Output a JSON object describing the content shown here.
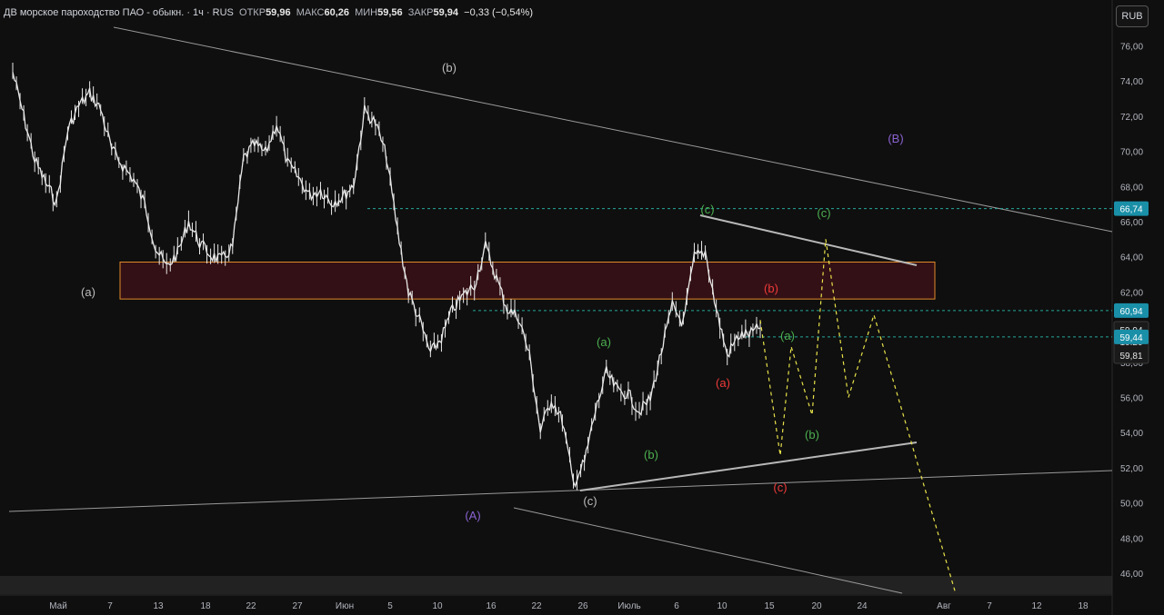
{
  "header": {
    "symbol": "ДВ морское пароходство ПАО - обыкн.",
    "interval": "· 1ч · RUS",
    "open_label": "ОТКР",
    "open": "59,96",
    "high_label": "МАКС",
    "high": "60,26",
    "low_label": "МИН",
    "low": "59,56",
    "close_label": "ЗАКР",
    "close": "59,94",
    "change": "−0,33 (−0,54%)"
  },
  "currency_button": "RUB",
  "colors": {
    "background": "#0f0f0f",
    "candles": "#e8e8e8",
    "zone_fill": "#3a1016",
    "zone_border": "#e08a2a",
    "projection": "#e8e24a",
    "level_line": "#26a69a",
    "wave_green": "#4caf50",
    "wave_red": "#ef3a3a",
    "wave_purple": "#8a63d2",
    "wave_gray": "#bdbdbd",
    "badge_teal": "#1a8fa8"
  },
  "chart_data": {
    "type": "line",
    "title": "",
    "ylim": [
      45,
      77.5
    ],
    "y_ticks": [
      "46,00",
      "48,00",
      "50,00",
      "52,00",
      "54,00",
      "56,00",
      "58,00",
      "60,00",
      "62,00",
      "64,00",
      "66,00",
      "68,00",
      "70,00",
      "72,00",
      "74,00",
      "76,00"
    ],
    "x_ticks": [
      "Май",
      "7",
      "13",
      "18",
      "22",
      "27",
      "Июн",
      "5",
      "10",
      "16",
      "22",
      "26",
      "Июль",
      "6",
      "10",
      "15",
      "20",
      "24",
      "Авг",
      "7",
      "12",
      "18"
    ],
    "series": [
      {
        "values": [
          74.5,
          72.0,
          69.5,
          68.2,
          67.1,
          71.2,
          72.6,
          73.3,
          72.4,
          70.1,
          69.2,
          68.4,
          67.0,
          64.5,
          63.4,
          64.2,
          66.0,
          64.8,
          64.1,
          63.8,
          64.6,
          69.6,
          70.4,
          69.9,
          71.6,
          69.3,
          68.5,
          67.5,
          67.8,
          67.1,
          67.4,
          68.1,
          72.3,
          71.6,
          69.7,
          65.5,
          62.0,
          60.4,
          58.5,
          59.4,
          61.0,
          61.8,
          62.4,
          64.6,
          62.8,
          61.0,
          60.6,
          58.4,
          54.1,
          55.9,
          54.7,
          51.1,
          52.3,
          55.2,
          57.4,
          56.4,
          56.2,
          55.2,
          55.9,
          58.6,
          61.2,
          60.2,
          64.0,
          64.3,
          61.0,
          58.4,
          59.5,
          59.6,
          59.94
        ]
      }
    ],
    "levels": [
      {
        "value": 66.74,
        "label": "66,74"
      },
      {
        "value": 60.94,
        "label": "60,94"
      },
      {
        "value": 59.44,
        "label": "59,44"
      }
    ],
    "price_badge": {
      "price": "59,94",
      "timer": "10:20",
      "low": "59,81"
    },
    "zone": {
      "low": 61.6,
      "high": 63.7
    },
    "projection": [
      [
        60.4,
        60.6
      ],
      [
        56.0,
        52.7
      ],
      [
        58.9,
        56.2
      ],
      [
        55.0,
        65.0
      ],
      [
        56.0,
        60.7
      ],
      [
        50.0,
        45.0
      ]
    ],
    "wave_labels": [
      {
        "text": "(b)",
        "color": "gray"
      },
      {
        "text": "(a)",
        "color": "gray"
      },
      {
        "text": "(B)",
        "color": "purple"
      },
      {
        "text": "(c)",
        "color": "green"
      },
      {
        "text": "(c)",
        "color": "green"
      },
      {
        "text": "(b)",
        "color": "red"
      },
      {
        "text": "(a)",
        "color": "green"
      },
      {
        "text": "(a)",
        "color": "green"
      },
      {
        "text": "(a)",
        "color": "red"
      },
      {
        "text": "(b)",
        "color": "green"
      },
      {
        "text": "(b)",
        "color": "green"
      },
      {
        "text": "(c)",
        "color": "red"
      },
      {
        "text": "(c)",
        "color": "gray"
      },
      {
        "text": "(A)",
        "color": "purple"
      }
    ]
  }
}
